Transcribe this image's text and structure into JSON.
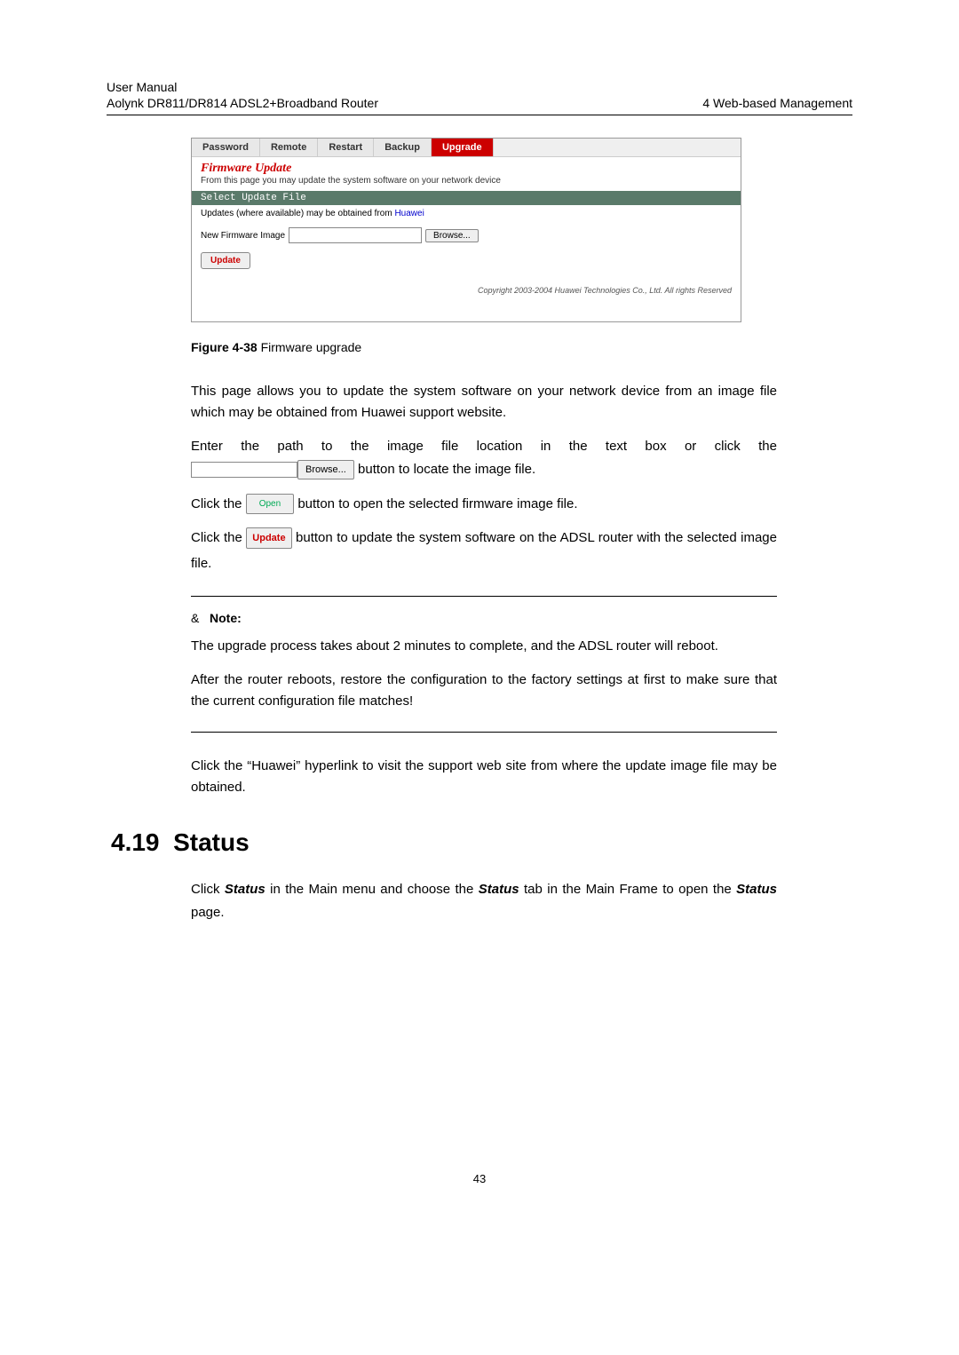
{
  "header": {
    "line1_left": "User Manual",
    "line2_left": "Aolynk DR811/DR814 ADSL2+Broadband Router",
    "right": "4  Web-based Management"
  },
  "screenshot": {
    "tabs": [
      "Password",
      "Remote",
      "Restart",
      "Backup",
      "Upgrade"
    ],
    "active_tab_index": 4,
    "title": "Firmware Update",
    "subtitle": "From this page you may update the system software on your network device",
    "section_bar": "Select Update File",
    "updates_prefix": "Updates (where available) may be obtained from ",
    "updates_link": "Huawei",
    "form_label": "New Firmware Image",
    "browse_btn": "Browse...",
    "update_btn": "Update",
    "copyright": "Copyright 2003-2004 Huawei Technologies Co., Ltd. All rights Reserved"
  },
  "figure": {
    "label": "Figure 4-38",
    "text": " Firmware upgrade"
  },
  "body": {
    "p1": "This page allows you to update the system software on your network device from an image file which may be obtained from Huawei support website.",
    "p2_line1": "Enter the path to the image file location in the text box or click the",
    "p2_browse": "Browse...",
    "p2_line2": " button to locate the image file.",
    "p3_a": "Click the ",
    "p3_open": "Open",
    "p3_b": " button to open the selected firmware image file.",
    "p4_a": "Click the ",
    "p4_update": "Update",
    "p4_b": " button to update the system software on the ADSL router with the selected image file.",
    "note_symbol": "&",
    "note_label": "Note:",
    "note_p1": "The upgrade process takes about 2 minutes to complete, and the ADSL router will reboot.",
    "note_p2": "After the router reboots, restore the configuration to the factory settings at first to make sure that the current configuration file matches!",
    "p5": "Click the “Huawei” hyperlink to visit the support web site from where the update image file may be obtained."
  },
  "section": {
    "number": "4.19",
    "title": "Status",
    "p_a": "Click ",
    "p_b": "Status",
    "p_c": "  in the Main menu and choose the  ",
    "p_d": "Status",
    "p_e": " tab in the Main Frame to open the ",
    "p_f": "Status",
    "p_g": " page."
  },
  "page_num": "43"
}
